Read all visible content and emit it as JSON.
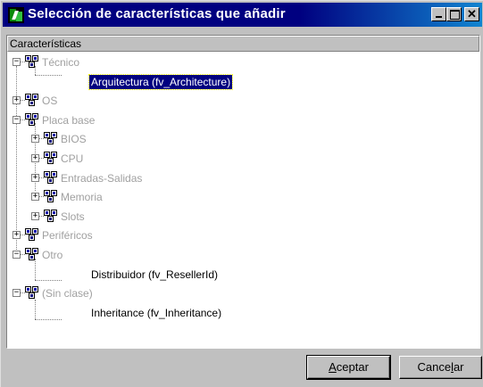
{
  "window": {
    "title": "Selección de características que añadir",
    "icon": "app-logo-icon"
  },
  "panel": {
    "column_header": "Características"
  },
  "tree": [
    {
      "label": "Técnico",
      "state": "expanded",
      "disabled": true
    },
    {
      "label": "Arquitectura (fv_Architecture)",
      "leaf": true,
      "selected": true
    },
    {
      "label": "OS",
      "state": "collapsed",
      "disabled": true
    },
    {
      "label": "Placa base",
      "state": "expanded",
      "disabled": true
    },
    {
      "label": "BIOS",
      "state": "collapsed",
      "disabled": true
    },
    {
      "label": "CPU",
      "state": "collapsed",
      "disabled": true
    },
    {
      "label": "Entradas-Salidas",
      "state": "collapsed",
      "disabled": true
    },
    {
      "label": "Memoria",
      "state": "collapsed",
      "disabled": true
    },
    {
      "label": "Slots",
      "state": "collapsed",
      "disabled": true
    },
    {
      "label": "Periféricos",
      "state": "collapsed",
      "disabled": true
    },
    {
      "label": "Otro",
      "state": "expanded",
      "disabled": true
    },
    {
      "label": "Distribuidor (fv_ResellerId)",
      "leaf": true
    },
    {
      "label": "(Sin clase)",
      "state": "expanded",
      "disabled": true
    },
    {
      "label": "Inheritance (fv_Inheritance)",
      "leaf": true
    }
  ],
  "buttons": {
    "ok_pre": "",
    "ok_key": "A",
    "ok_post": "ceptar",
    "cancel_pre": "Cance",
    "cancel_key": "l",
    "cancel_post": "ar"
  }
}
